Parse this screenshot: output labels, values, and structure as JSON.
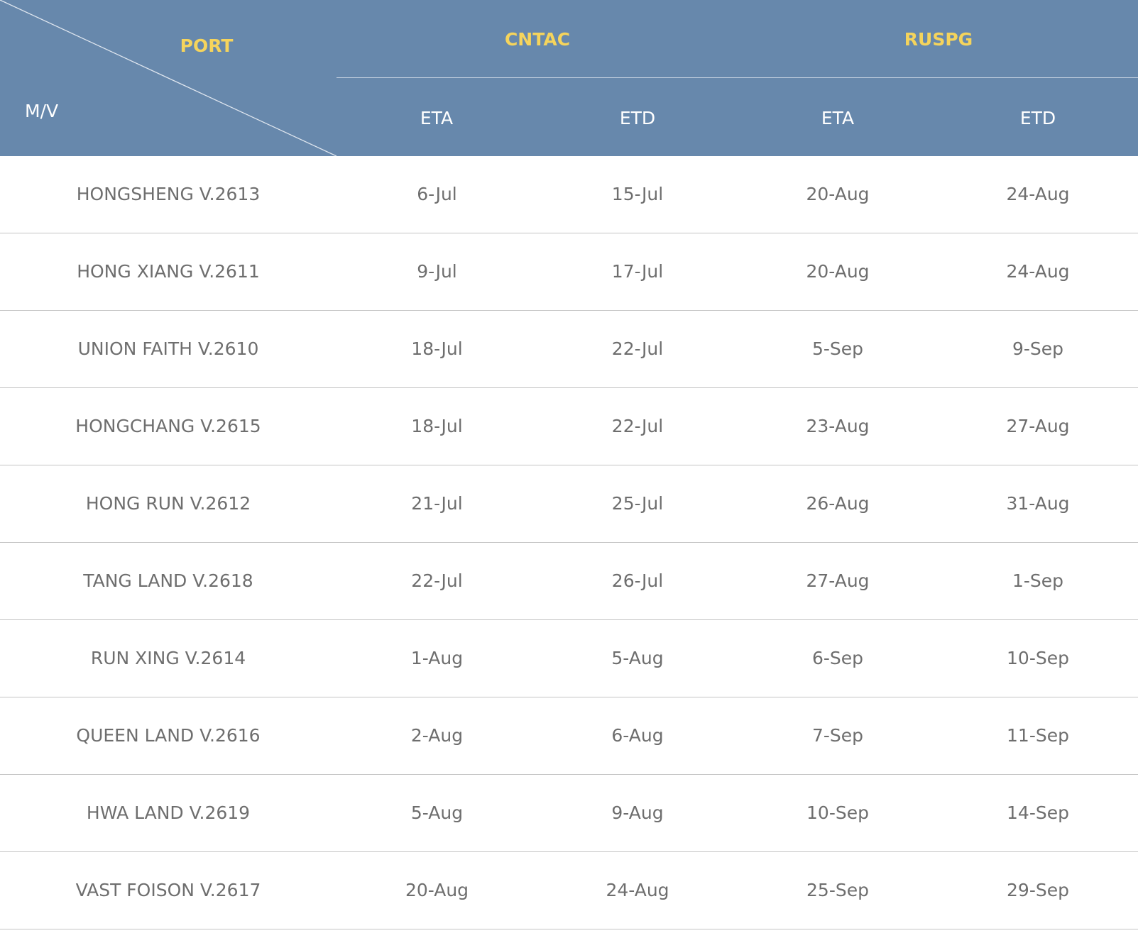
{
  "table": {
    "corner": {
      "top_label": "PORT",
      "bottom_label": "M/V"
    },
    "port_groups": [
      {
        "name": "CNTAC",
        "columns": [
          "ETA",
          "ETD"
        ]
      },
      {
        "name": "RUSPG",
        "columns": [
          "ETA",
          "ETD"
        ]
      }
    ],
    "rows": [
      {
        "vessel": "HONGSHENG V.2613",
        "cntac_eta": "6-Jul",
        "cntac_etd": "15-Jul",
        "ruspg_eta": "20-Aug",
        "ruspg_etd": "24-Aug"
      },
      {
        "vessel": "HONG XIANG V.2611",
        "cntac_eta": "9-Jul",
        "cntac_etd": "17-Jul",
        "ruspg_eta": "20-Aug",
        "ruspg_etd": "24-Aug"
      },
      {
        "vessel": "UNION FAITH V.2610",
        "cntac_eta": "18-Jul",
        "cntac_etd": "22-Jul",
        "ruspg_eta": "5-Sep",
        "ruspg_etd": "9-Sep"
      },
      {
        "vessel": "HONGCHANG V.2615",
        "cntac_eta": "18-Jul",
        "cntac_etd": "22-Jul",
        "ruspg_eta": "23-Aug",
        "ruspg_etd": "27-Aug"
      },
      {
        "vessel": "HONG RUN V.2612",
        "cntac_eta": "21-Jul",
        "cntac_etd": "25-Jul",
        "ruspg_eta": "26-Aug",
        "ruspg_etd": "31-Aug"
      },
      {
        "vessel": "TANG LAND V.2618",
        "cntac_eta": "22-Jul",
        "cntac_etd": "26-Jul",
        "ruspg_eta": "27-Aug",
        "ruspg_etd": "1-Sep"
      },
      {
        "vessel": "RUN XING V.2614",
        "cntac_eta": "1-Aug",
        "cntac_etd": "5-Aug",
        "ruspg_eta": "6-Sep",
        "ruspg_etd": "10-Sep"
      },
      {
        "vessel": "QUEEN LAND V.2616",
        "cntac_eta": "2-Aug",
        "cntac_etd": "6-Aug",
        "ruspg_eta": "7-Sep",
        "ruspg_etd": "11-Sep"
      },
      {
        "vessel": "HWA LAND V.2619",
        "cntac_eta": "5-Aug",
        "cntac_etd": "9-Aug",
        "ruspg_eta": "10-Sep",
        "ruspg_etd": "14-Sep"
      },
      {
        "vessel": "VAST FOISON V.2617",
        "cntac_eta": "20-Aug",
        "cntac_etd": "24-Aug",
        "ruspg_eta": "25-Sep",
        "ruspg_etd": "29-Sep"
      }
    ]
  },
  "colors": {
    "header_bg": "#6788ac",
    "header_accent": "#f5d45c",
    "header_text": "#ffffff",
    "cell_text": "#6e6e6e",
    "row_divider": "#c4c4c4"
  }
}
